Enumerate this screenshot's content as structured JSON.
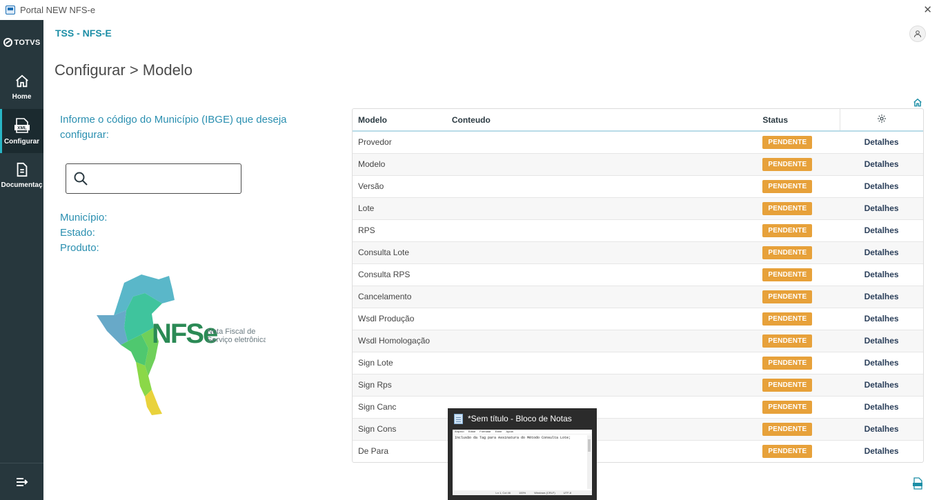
{
  "window": {
    "title": "Portal NEW NFS-e",
    "close_glyph": "✕"
  },
  "brand": {
    "logo_text": "TOTVS"
  },
  "sidebar": {
    "items": [
      {
        "label": "Home",
        "icon": "home-icon",
        "active": false
      },
      {
        "label": "Configurar",
        "icon": "xml-file-icon",
        "active": true
      },
      {
        "label": "Documentaç",
        "icon": "document-icon",
        "active": false
      }
    ],
    "collapse_icon": "collapse-menu-icon"
  },
  "header": {
    "app_name": "TSS - NFS-E",
    "avatar_icon": "user-icon"
  },
  "page": {
    "breadcrumb": "Configurar > Modelo"
  },
  "left_panel": {
    "instruction": "Informe o código do Município (IBGE) que deseja configurar:",
    "search": {
      "value": "",
      "placeholder": ""
    },
    "municipio_label": "Município:",
    "estado_label": "Estado:",
    "produto_label": "Produto:",
    "logo": {
      "word": "NFSe",
      "line1": "Nota Fiscal de",
      "line2": "Serviço eletrônica"
    }
  },
  "table": {
    "headers": {
      "modelo": "Modelo",
      "conteudo": "Conteudo",
      "status": "Status",
      "settings_icon": "gear-icon"
    },
    "rows": [
      {
        "modelo": "Provedor",
        "conteudo": "",
        "status": "PENDENTE",
        "action": "Detalhes"
      },
      {
        "modelo": "Modelo",
        "conteudo": "",
        "status": "PENDENTE",
        "action": "Detalhes"
      },
      {
        "modelo": "Versão",
        "conteudo": "",
        "status": "PENDENTE",
        "action": "Detalhes"
      },
      {
        "modelo": "Lote",
        "conteudo": "",
        "status": "PENDENTE",
        "action": "Detalhes"
      },
      {
        "modelo": "RPS",
        "conteudo": "",
        "status": "PENDENTE",
        "action": "Detalhes"
      },
      {
        "modelo": "Consulta Lote",
        "conteudo": "",
        "status": "PENDENTE",
        "action": "Detalhes"
      },
      {
        "modelo": "Consulta RPS",
        "conteudo": "",
        "status": "PENDENTE",
        "action": "Detalhes"
      },
      {
        "modelo": "Cancelamento",
        "conteudo": "",
        "status": "PENDENTE",
        "action": "Detalhes"
      },
      {
        "modelo": "Wsdl Produção",
        "conteudo": "",
        "status": "PENDENTE",
        "action": "Detalhes"
      },
      {
        "modelo": "Wsdl Homologação",
        "conteudo": "",
        "status": "PENDENTE",
        "action": "Detalhes"
      },
      {
        "modelo": "Sign Lote",
        "conteudo": "",
        "status": "PENDENTE",
        "action": "Detalhes"
      },
      {
        "modelo": "Sign Rps",
        "conteudo": "",
        "status": "PENDENTE",
        "action": "Detalhes"
      },
      {
        "modelo": "Sign Canc",
        "conteudo": "",
        "status": "PENDENTE",
        "action": "Detalhes"
      },
      {
        "modelo": "Sign Cons",
        "conteudo": "",
        "status": "PENDENTE",
        "action": "Detalhes"
      },
      {
        "modelo": "De Para",
        "conteudo": "",
        "status": "PENDENTE",
        "action": "Detalhes"
      }
    ]
  },
  "taskbar_preview": {
    "title": "*Sem título - Bloco de Notas",
    "menu": [
      "Arquivo",
      "Editar",
      "Formatar",
      "Exibir",
      "Ajuda"
    ],
    "content": "Inclusão da Tag para Assinatura do Método Consulta Lote;",
    "status": [
      "Ln 1, Col 46",
      "100%",
      "Windows (CRLF)",
      "UTF-8"
    ]
  },
  "colors": {
    "accent": "#1c8ea6",
    "sidebar_bg": "#27373d",
    "badge": "#e7a13a",
    "link": "#2b3f5a"
  }
}
